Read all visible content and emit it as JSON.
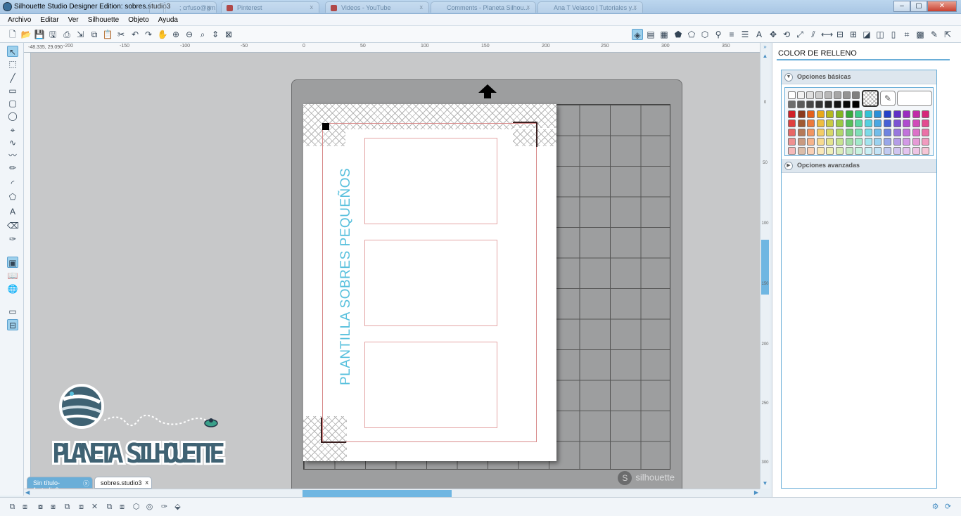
{
  "window": {
    "title": "Silhouette Studio Designer Edition: sobres.studio3",
    "browser_tabs": [
      "",
      "; crfuso@gm...",
      "Pinterest",
      "Videos - YouTube",
      "Comments - Planeta Silhou...",
      "Ana T Velasco | Tutoriales y..."
    ]
  },
  "menu": [
    "Archivo",
    "Editar",
    "Ver",
    "Silhouette",
    "Objeto",
    "Ayuda"
  ],
  "ruler": {
    "coords": "-48.335, 29.090",
    "top_labels": [
      "-200",
      "-150",
      "-100",
      "-50",
      "0",
      "50",
      "100",
      "150",
      "200",
      "250",
      "300",
      "350"
    ],
    "right_labels": [
      "0",
      "50",
      "100",
      "150",
      "200",
      "250",
      "300"
    ]
  },
  "canvas": {
    "vertical_text": "PLANTILLA SOBRES PEQUEÑOS",
    "mat_logo": "silhouette",
    "mat_logo_letter": "S",
    "text_color": "#58c0dd",
    "cut_color": "#d88a8a"
  },
  "doc_tabs": [
    {
      "label": "Sin título-1.studio3",
      "active": false
    },
    {
      "label": "sobres.studio3",
      "active": true
    }
  ],
  "panel": {
    "title": "COLOR DE RELLENO",
    "basic_label": "Opciones básicas",
    "advanced_label": "Opciones avanzadas"
  },
  "palette": {
    "gray_row1": [
      "#ffffff",
      "#f2f2f2",
      "#e0e0e0",
      "#cccccc",
      "#b8b8b8",
      "#a6a6a6",
      "#939393",
      "#808080"
    ],
    "gray_row2": [
      "#6d6d6d",
      "#5b5b5b",
      "#484848",
      "#363636",
      "#242424",
      "#141414",
      "#0a0a0a",
      "#000000"
    ],
    "rows": [
      [
        "#d12027",
        "#8b3a1e",
        "#e25f1c",
        "#e8a81b",
        "#b5b820",
        "#83b522",
        "#38a83a",
        "#3dc98c",
        "#34c2d5",
        "#2a8fd8",
        "#2441c8",
        "#6130c5",
        "#9b2bc0",
        "#c12aa8",
        "#d6287a"
      ],
      [
        "#e0403f",
        "#a15a33",
        "#eb7a3d",
        "#eebd3f",
        "#c8ca41",
        "#9bc943",
        "#55bf59",
        "#5ad6a2",
        "#55d0e0",
        "#4aa7e3",
        "#4760d6",
        "#7c52d2",
        "#b04ccf",
        "#d14bb9",
        "#e34a90"
      ],
      [
        "#e86766",
        "#b67958",
        "#f19561",
        "#f3cc66",
        "#d7d868",
        "#b1d76a",
        "#7ace7e",
        "#7ee0b7",
        "#7cdbe8",
        "#72bdea",
        "#6f83e0",
        "#9877dd",
        "#c272db",
        "#dc71c8",
        "#eb71a7"
      ],
      [
        "#ef9090",
        "#c99a80",
        "#f5b38b",
        "#f7da90",
        "#e4e48f",
        "#c7e391",
        "#a0dca3",
        "#a3eacb",
        "#a3e5ef",
        "#9bd2f0",
        "#98a6e9",
        "#b49de7",
        "#d399e6",
        "#e69ad6",
        "#f19bbf"
      ],
      [
        "#f5b9b9",
        "#dbbda9",
        "#f9d0b5",
        "#fae8b8",
        "#eff0b8",
        "#dbedb9",
        "#c6eac8",
        "#c8f2df",
        "#c9eff5",
        "#c3e3f6",
        "#c1caf1",
        "#d0c5f0",
        "#e4c3ef",
        "#efc4e5",
        "#f6c5d6"
      ]
    ],
    "selected": "none"
  }
}
